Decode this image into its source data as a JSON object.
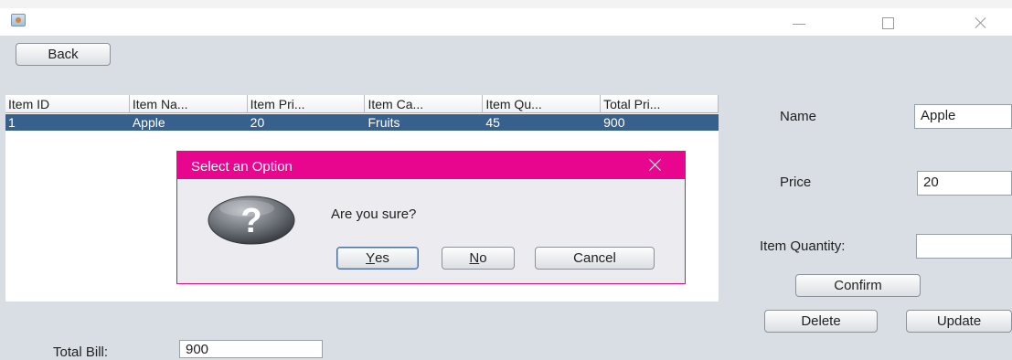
{
  "titlebar": {
    "icon": "java-app-icon"
  },
  "toolbar": {
    "back_label": "Back"
  },
  "table": {
    "columns": [
      "Item ID",
      "Item Na...",
      "Item Pri...",
      "Item Ca...",
      "Item Qu...",
      "Total Pri..."
    ],
    "rows": [
      [
        "1",
        "Apple",
        "20",
        "Fruits",
        "45",
        "900"
      ]
    ]
  },
  "dialog": {
    "title": "Select an Option",
    "message": "Are you sure?",
    "icon": "question-icon",
    "buttons": {
      "yes": {
        "mnemonic": "Y",
        "rest": "es"
      },
      "no": {
        "mnemonic": "N",
        "rest": "o"
      },
      "cancel": "Cancel"
    },
    "accent": "#e8068e"
  },
  "form": {
    "name_label": "Name",
    "name_value": "Apple",
    "price_label": "Price",
    "price_value": "20",
    "quantity_label": "Item Quantity:",
    "quantity_value": "",
    "confirm_label": "Confirm",
    "delete_label": "Delete",
    "update_label": "Update"
  },
  "bill": {
    "label": "Total Bill:",
    "value": "900"
  },
  "colors": {
    "selection": "#37608d",
    "background": "#d9dde4"
  }
}
